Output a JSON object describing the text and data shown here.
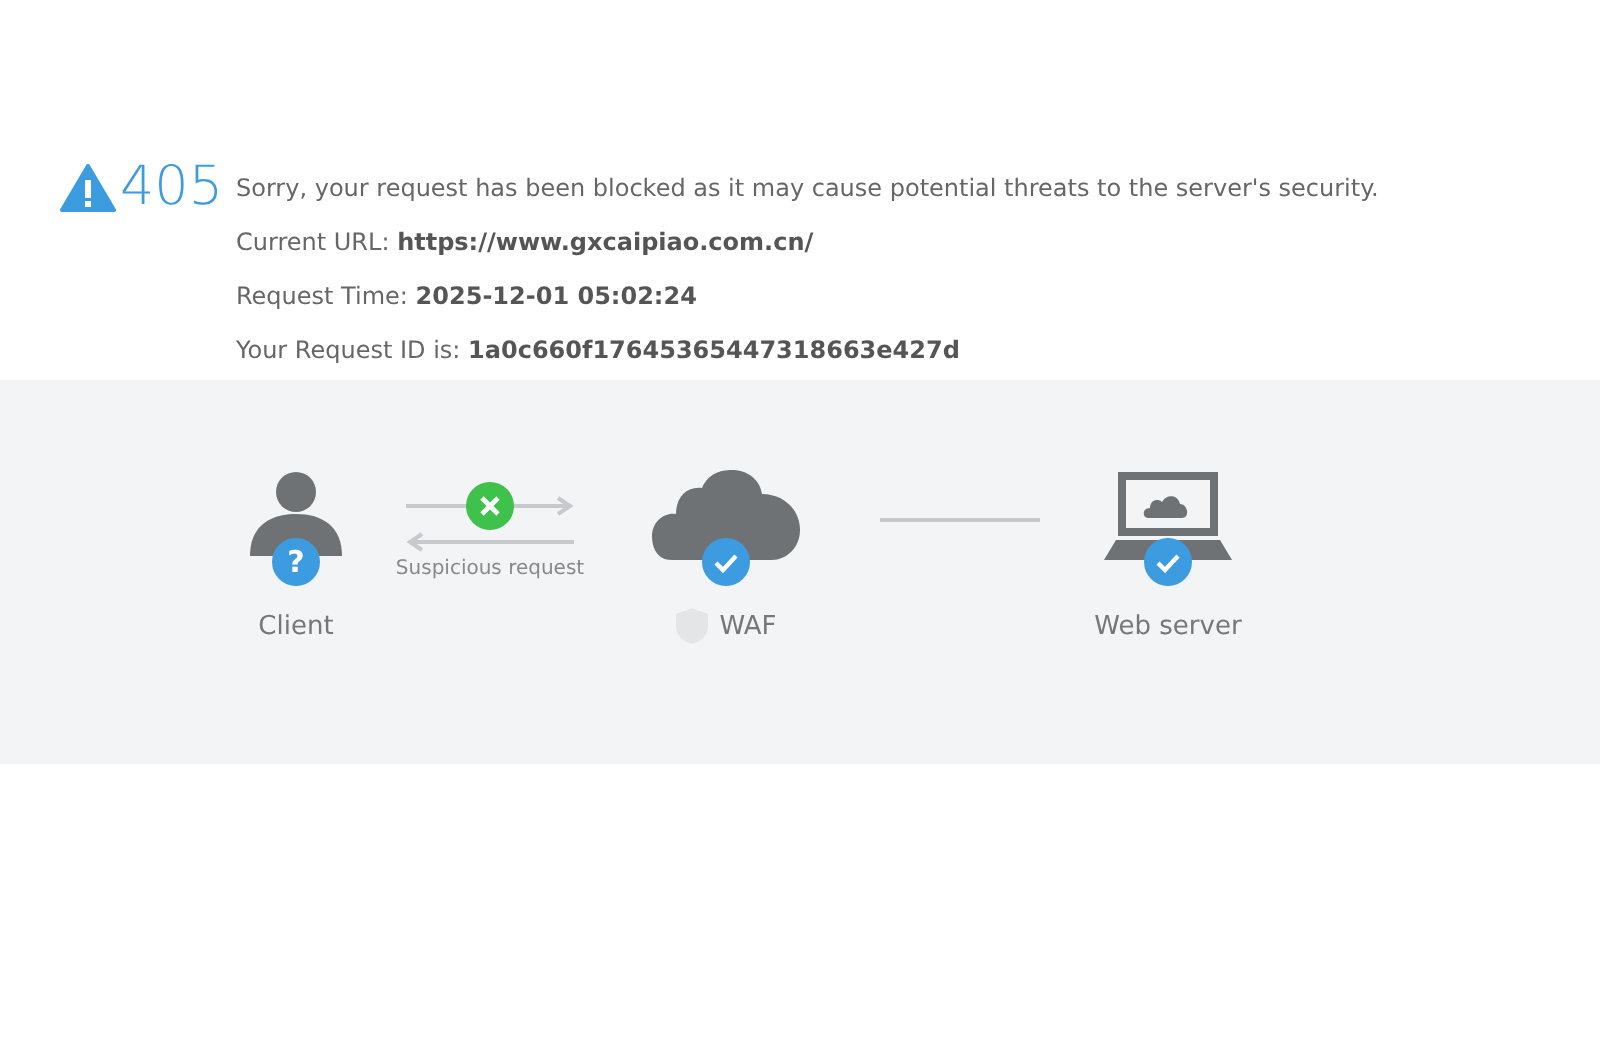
{
  "error": {
    "code": "405",
    "message": "Sorry, your request has been blocked as it may cause potential threats to the server's security."
  },
  "details": [
    {
      "label": "Current URL:",
      "value": "https://www.gxcaipiao.com.cn/"
    },
    {
      "label": "Request Time:",
      "value": "2025-12-01 05:02:24"
    },
    {
      "label": "Your Request ID is:",
      "value": "1a0c660f17645365447318663e427d"
    }
  ],
  "diagram": {
    "nodes": [
      {
        "kind": "client",
        "label": "Client",
        "badge": "?"
      },
      {
        "kind": "waf",
        "label": "WAF",
        "verified": true
      },
      {
        "kind": "server",
        "label": "Web server",
        "verified": true
      }
    ],
    "request": {
      "label": "Suspicious request",
      "blocked": true
    }
  }
}
